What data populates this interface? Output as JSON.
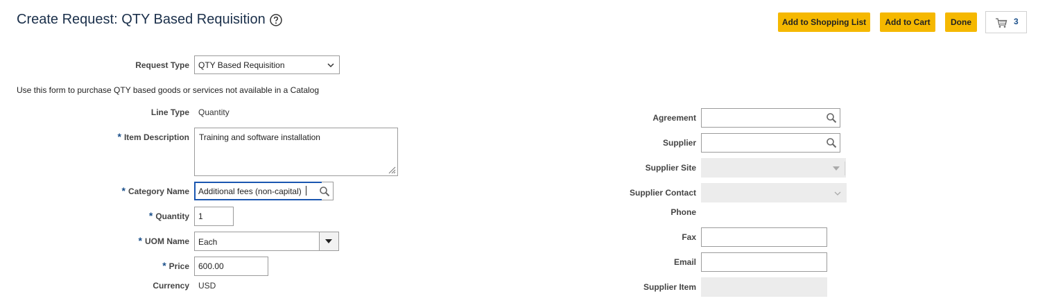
{
  "header": {
    "title": "Create Request: QTY Based Requisition",
    "add_to_shopping_list": "Add to Shopping List",
    "add_to_cart": "Add to Cart",
    "done": "Done",
    "cart_count": "3"
  },
  "form": {
    "request_type_label": "Request Type",
    "request_type_value": "QTY Based Requisition",
    "intro": "Use this form to purchase QTY based goods or services not available in a Catalog",
    "line_type_label": "Line Type",
    "line_type_value": "Quantity",
    "required_marker": "*",
    "item_description_label": "Item Description",
    "item_description_value": "Training and software installation",
    "category_name_label": "Category Name",
    "category_name_value": "Additional fees (non-capital)",
    "quantity_label": "Quantity",
    "quantity_value": "1",
    "uom_name_label": "UOM Name",
    "uom_name_value": "Each",
    "price_label": "Price",
    "price_value": "600.00",
    "currency_label": "Currency",
    "currency_value": "USD"
  },
  "supplier": {
    "agreement_label": "Agreement",
    "agreement_value": "",
    "supplier_label": "Supplier",
    "supplier_value": "",
    "supplier_site_label": "Supplier Site",
    "supplier_contact_label": "Supplier Contact",
    "phone_label": "Phone",
    "fax_label": "Fax",
    "fax_value": "",
    "email_label": "Email",
    "email_value": "",
    "supplier_item_label": "Supplier Item"
  },
  "colors": {
    "accent_button": "#f5b800",
    "required_marker": "#1a4f8a",
    "focus_border": "#1a56b0"
  },
  "icons": [
    "help-icon",
    "cart-icon",
    "chevron-down-icon",
    "search-icon",
    "resize-grip-icon",
    "triangle-down-icon"
  ]
}
